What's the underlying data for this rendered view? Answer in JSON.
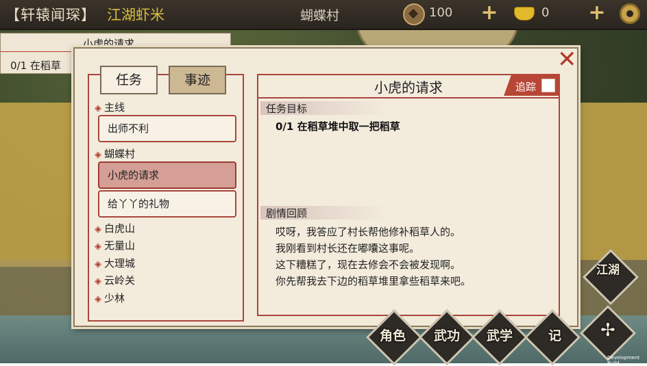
{
  "topbar": {
    "title": "【轩辕闻琛】",
    "player_name": "江湖虾米",
    "location": "蝴蝶村",
    "coins": "100",
    "ingots": "0"
  },
  "tracker": {
    "title": "小虎的请求",
    "text": "0/1  在稻草"
  },
  "tabs": {
    "task": "任务",
    "story": "事迹"
  },
  "quest_list": {
    "group_main": "主线",
    "item_1": "出师不利",
    "group_village": "蝴蝶村",
    "item_selected": "小虎的请求",
    "item_3": "给丫丫的礼物",
    "regions": [
      "白虎山",
      "无量山",
      "大理城",
      "云岭关",
      "少林"
    ]
  },
  "detail": {
    "title": "小虎的请求",
    "track_label": "追踪",
    "objective_head": "任务目标",
    "objective": "0/1 在稻草堆中取一把稻草",
    "recap_head": "剧情回顾",
    "recap_lines": [
      "哎呀，我答应了村长帮他修补稻草人的。",
      "我刚看到村长还在嘟囔这事呢。",
      "这下糟糕了，现在去修会不会被发现啊。",
      "你先帮我去下边的稻草堆里拿些稻草来吧。"
    ]
  },
  "hud": {
    "jianghu": "江湖",
    "role": "角色",
    "martial": "武功",
    "learn": "武学",
    "notes": "记"
  },
  "footer": {
    "dev_build": "Development Build"
  },
  "colors": {
    "accent_red": "#a8453a",
    "gold": "#d8bf3f",
    "panel_bg": "#f2ead9"
  }
}
